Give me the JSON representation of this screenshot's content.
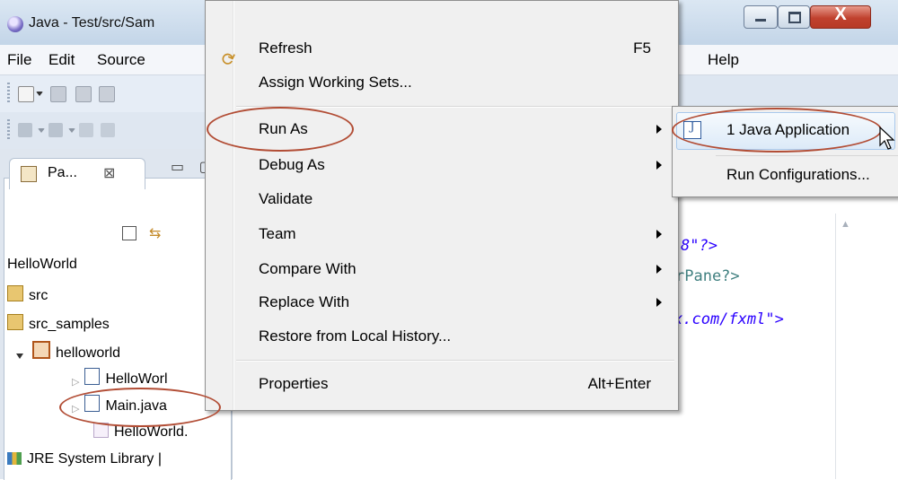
{
  "window": {
    "title": "Java - Test/src/Sam",
    "close_glyph": "X"
  },
  "menubar": {
    "items": [
      "File",
      "Edit",
      "Source",
      "Help"
    ]
  },
  "package_explorer": {
    "tab_label": "Pa...",
    "tab_close": "⊠",
    "tab_controls": "▭ ▢",
    "tree": [
      {
        "label": "HelloWorld"
      },
      {
        "label": "src"
      },
      {
        "label": "src_samples"
      },
      {
        "label": "helloworld"
      },
      {
        "label": "HelloWorl"
      },
      {
        "label": "Main.java"
      },
      {
        "label": "HelloWorld."
      },
      {
        "label": "JRE System Library |"
      }
    ]
  },
  "editor": {
    "lines": [
      "8\"?>",
      "rPane?>",
      "x.com/fxml\">"
    ]
  },
  "context_menu": {
    "items": [
      {
        "label": "Refresh",
        "shortcut": "F5"
      },
      {
        "label": "Assign Working Sets..."
      },
      {
        "label": "Run As",
        "submenu": true
      },
      {
        "label": "Debug As",
        "submenu": true
      },
      {
        "label": "Validate"
      },
      {
        "label": "Team",
        "submenu": true
      },
      {
        "label": "Compare With",
        "submenu": true
      },
      {
        "label": "Replace With",
        "submenu": true
      },
      {
        "label": "Restore from Local History..."
      },
      {
        "label": "Properties",
        "shortcut": "Alt+Enter"
      }
    ]
  },
  "submenu": {
    "items": [
      {
        "label": "1 Java Application",
        "icon": "java-app-icon"
      },
      {
        "label": "Run Configurations..."
      }
    ]
  },
  "colors": {
    "highlight_ring": "#b24d35",
    "menu_bg": "#f0f0f0"
  }
}
